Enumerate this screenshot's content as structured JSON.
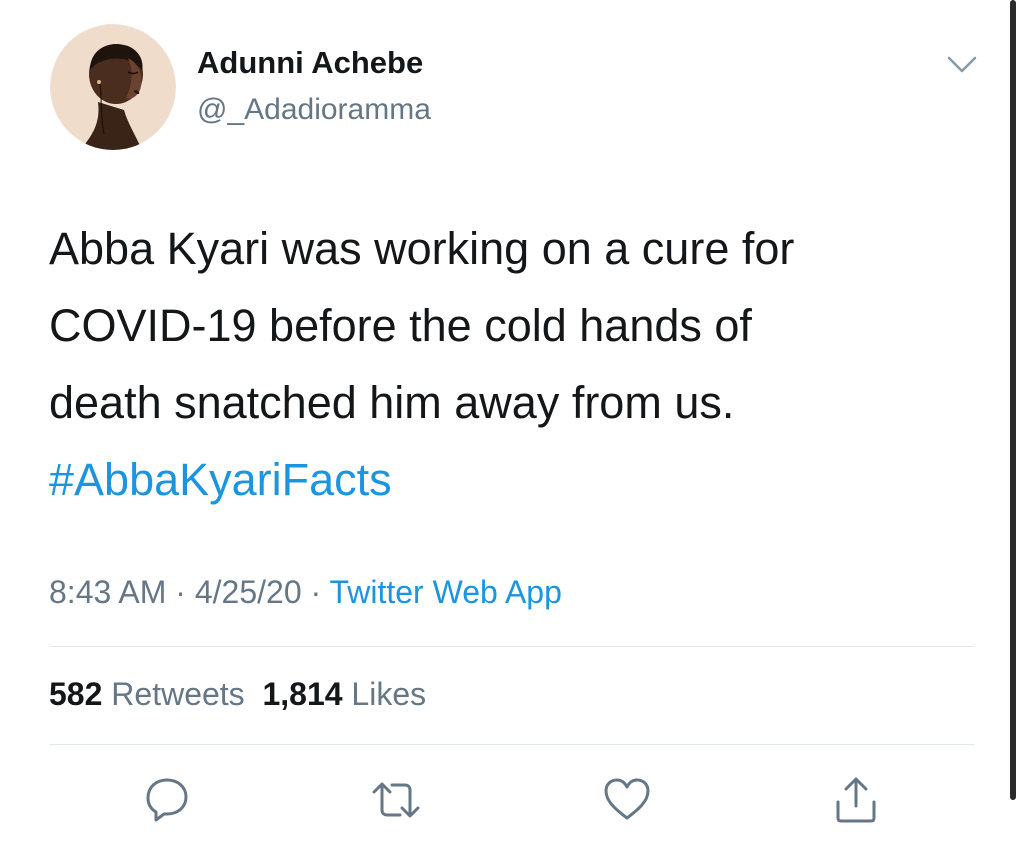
{
  "tweet": {
    "author": {
      "display_name": "Adunni Achebe",
      "handle": "@_Adadioramma"
    },
    "text_lines": [
      "Abba Kyari was working on a cure for",
      "COVID-19 before the cold hands of",
      "death snatched him away from us."
    ],
    "hashtag": "#AbbaKyariFacts",
    "time": "8:43 AM",
    "separator": " · ",
    "date": "4/25/20",
    "source": "Twitter Web App",
    "retweets": {
      "count": "582",
      "label": "Retweets"
    },
    "likes": {
      "count": "1,814",
      "label": "Likes"
    }
  },
  "icons": {
    "more": "chevron-down-icon",
    "reply": "reply-icon",
    "retweet": "retweet-icon",
    "like": "heart-icon",
    "share": "share-icon"
  },
  "colors": {
    "link": "#1b95e0",
    "text": "#14171a",
    "secondary": "#657786",
    "divider": "#e1e8ed"
  }
}
